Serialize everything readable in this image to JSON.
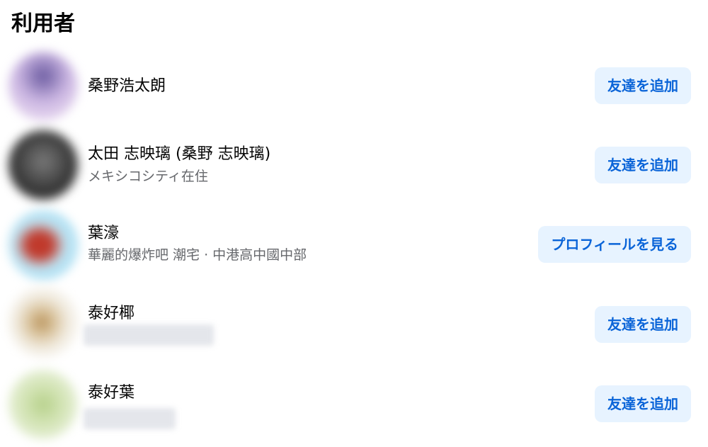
{
  "section": {
    "title": "利用者"
  },
  "results": [
    {
      "name": "桑野浩太朗",
      "subtitle": "",
      "action_label": "友達を追加",
      "avatar_colors": [
        "#cbb6e2",
        "#e8d9f0",
        "#6a5aa0"
      ]
    },
    {
      "name": "太田 志映璃 (桑野 志映璃)",
      "subtitle": "メキシコシティ在住",
      "action_label": "友達を追加",
      "avatar_colors": [
        "#3a3a3a",
        "#7a7a7a",
        "#1c1c1c"
      ]
    },
    {
      "name": "葉濠",
      "subtitle": "華麗的爆炸吧 潮宅 · 中港高中國中部",
      "action_label": "プロフィールを見る",
      "avatar_colors": [
        "#bfe6f5",
        "#c0392b",
        "#8fd3ee"
      ]
    },
    {
      "name": "泰好椰",
      "subtitle": "",
      "action_label": "友達を追加",
      "avatar_colors": [
        "#f3efe6",
        "#b9925a",
        "#f6f3ec"
      ]
    },
    {
      "name": "泰好葉",
      "subtitle": "",
      "action_label": "友達を追加",
      "avatar_colors": [
        "#e2edcf",
        "#b6d08a",
        "#f0f5e6"
      ]
    }
  ],
  "colors": {
    "button_bg": "#e7f3ff",
    "button_text": "#0a64d8",
    "secondary_text": "#65676b"
  }
}
